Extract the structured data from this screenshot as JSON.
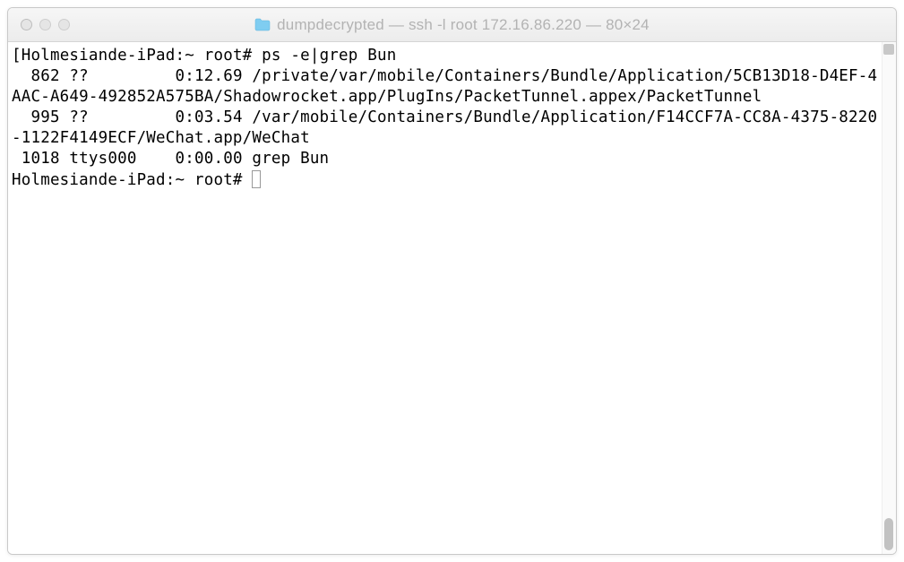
{
  "titlebar": {
    "title": "dumpdecrypted — ssh -l root 172.16.86.220 — 80×24",
    "folder_icon": "folder-icon"
  },
  "terminal": {
    "prompt1": {
      "bracket_open": "[",
      "host": "Holmesiande-iPad:~ root# ",
      "command": "ps -e|grep Bun"
    },
    "output_lines": [
      "  862 ??         0:12.69 /private/var/mobile/Containers/Bundle/Application/5CB13D18-D4EF-4AAC-A649-492852A575BA/Shadowrocket.app/PlugIns/PacketTunnel.appex/PacketTunnel",
      "  995 ??         0:03.54 /var/mobile/Containers/Bundle/Application/F14CCF7A-CC8A-4375-8220-1122F4149ECF/WeChat.app/WeChat",
      " 1018 ttys000    0:00.00 grep Bun"
    ],
    "prompt2": {
      "host": "Holmesiande-iPad:~ root# "
    }
  }
}
